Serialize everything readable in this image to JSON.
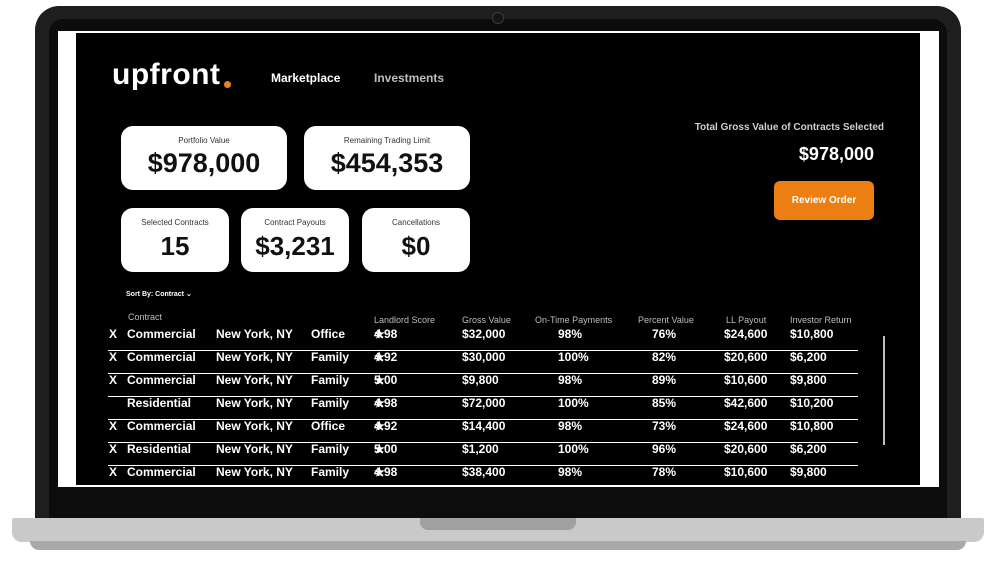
{
  "app": {
    "logo": "upfront"
  },
  "nav": {
    "items": [
      "Marketplace",
      "Investments"
    ]
  },
  "cards": [
    {
      "label": "Portfolio Value",
      "value": "$978,000"
    },
    {
      "label": "Remaining Trading Limit",
      "value": "$454,353"
    },
    {
      "label": "Selected Contracts",
      "value": "15"
    },
    {
      "label": "Contract Payouts",
      "value": "$3,231"
    },
    {
      "label": "Cancellations",
      "value": "$0"
    }
  ],
  "summary": {
    "total_label": "Total Gross Value of Contracts Selected",
    "total_value": "$978,000",
    "review_button": "Review Order"
  },
  "sort": {
    "label": "Sort By: Contract"
  },
  "table": {
    "headers": [
      "Contract",
      "Landlord Score",
      "Gross Value",
      "On-Time Payments",
      "Percent Value",
      "LL Payout",
      "Investor Return"
    ],
    "rows": [
      {
        "x": "X",
        "type": "Commercial",
        "location": "New York, NY",
        "property": "Office",
        "score": "4.98",
        "gross": "$32,000",
        "ontime": "98%",
        "pct": "76%",
        "ll": "$24,600",
        "inv": "$10,800"
      },
      {
        "x": "X",
        "type": "Commercial",
        "location": "New York, NY",
        "property": "Family",
        "score": "4.92",
        "gross": "$30,000",
        "ontime": "100%",
        "pct": "82%",
        "ll": "$20,600",
        "inv": "$6,200"
      },
      {
        "x": "X",
        "type": "Commercial",
        "location": "New York, NY",
        "property": "Family",
        "score": "5.00",
        "gross": "$9,800",
        "ontime": "98%",
        "pct": "89%",
        "ll": "$10,600",
        "inv": "$9,800"
      },
      {
        "x": "",
        "type": "Residential",
        "location": "New York, NY",
        "property": "Family",
        "score": "4.98",
        "gross": "$72,000",
        "ontime": "100%",
        "pct": "85%",
        "ll": "$42,600",
        "inv": "$10,200"
      },
      {
        "x": "X",
        "type": "Commercial",
        "location": "New York, NY",
        "property": "Office",
        "score": "4.92",
        "gross": "$14,400",
        "ontime": "98%",
        "pct": "73%",
        "ll": "$24,600",
        "inv": "$10,800"
      },
      {
        "x": "X",
        "type": "Residential",
        "location": "New York, NY",
        "property": "Family",
        "score": "5.00",
        "gross": "$1,200",
        "ontime": "100%",
        "pct": "96%",
        "ll": "$20,600",
        "inv": "$6,200"
      },
      {
        "x": "X",
        "type": "Commercial",
        "location": "New York, NY",
        "property": "Family",
        "score": "4.98",
        "gross": "$38,400",
        "ontime": "98%",
        "pct": "78%",
        "ll": "$10,600",
        "inv": "$9,800"
      }
    ]
  },
  "colors": {
    "accent": "#ec7f12",
    "background": "#000000",
    "card": "#ffffff"
  }
}
